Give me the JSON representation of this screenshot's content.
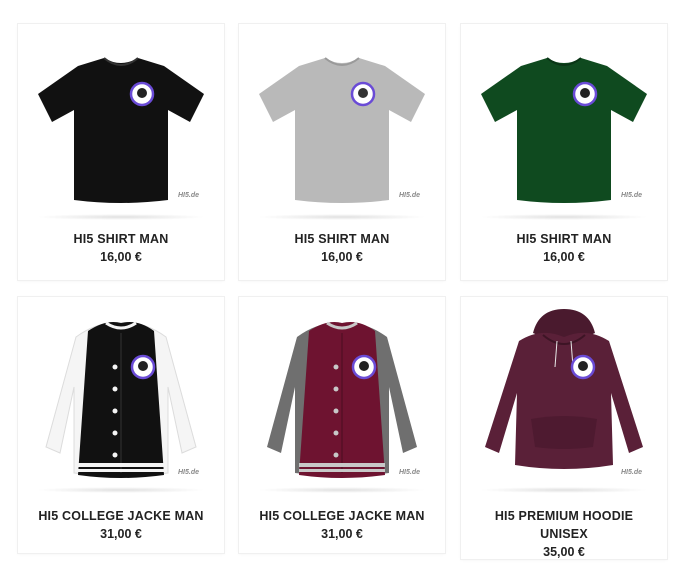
{
  "products": [
    {
      "title": "HI5 SHIRT MAN",
      "price": "16,00 €",
      "color": "#111111",
      "watermark": "HI5.de"
    },
    {
      "title": "HI5 SHIRT MAN",
      "price": "16,00 €",
      "color": "#b9b9b9",
      "watermark": "HI5.de"
    },
    {
      "title": "HI5 SHIRT MAN",
      "price": "16,00 €",
      "color": "#0f4a1f",
      "watermark": "HI5.de"
    },
    {
      "title": "HI5 COLLEGE JACKE MAN",
      "price": "31,00 €",
      "color": "#111111",
      "sleeve_color": "#f5f5f5",
      "watermark": "HI5.de"
    },
    {
      "title": "HI5 COLLEGE JACKE MAN",
      "price": "31,00 €",
      "color": "#6e1330",
      "sleeve_color": "#6f6f6f",
      "watermark": "HI5.de"
    },
    {
      "title": "HI5 PREMIUM HOODIE UNISEX",
      "title_line1": "HI5 PREMIUM HOODIE",
      "title_line2": "UNISEX",
      "price": "35,00 €",
      "color": "#5a2038",
      "watermark": "HI5.de"
    }
  ]
}
